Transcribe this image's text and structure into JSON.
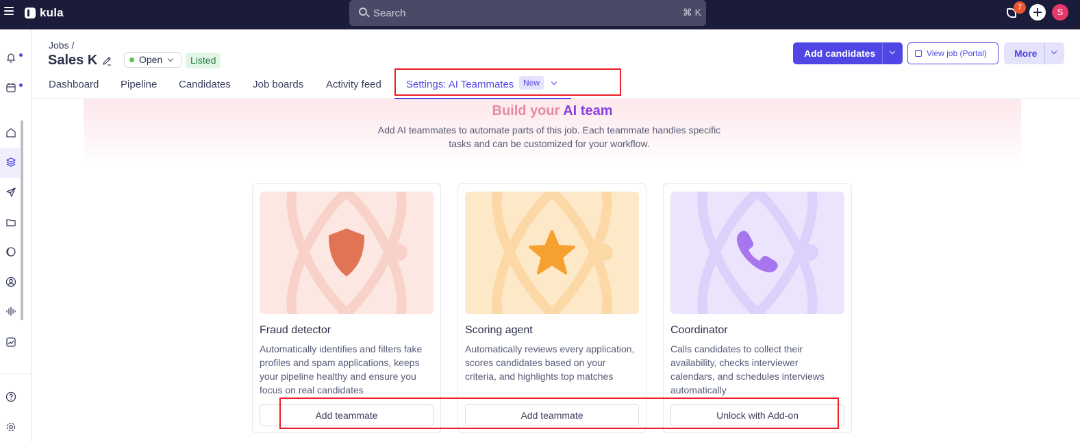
{
  "topbar": {
    "logo_text": "kula",
    "search_placeholder": "Search",
    "search_shortcut": "⌘ K",
    "notification_count": "7",
    "avatar_initial": "S"
  },
  "header": {
    "breadcrumb": "Jobs /",
    "job_title": "Sales K",
    "status": "Open",
    "listed_label": "Listed",
    "add_candidates_label": "Add candidates",
    "view_job_label": "View job (Portal)",
    "more_label": "More"
  },
  "tabs": [
    {
      "label": "Dashboard"
    },
    {
      "label": "Pipeline"
    },
    {
      "label": "Candidates"
    },
    {
      "label": "Job boards"
    },
    {
      "label": "Activity feed"
    },
    {
      "label": "Settings: AI Teammates",
      "badge": "New"
    }
  ],
  "banner": {
    "title_part1": "Build your",
    "title_part2": "AI team",
    "subtitle": "Add AI teammates to automate parts of this job. Each teammate handles specific tasks and can be customized for your workflow."
  },
  "cards": [
    {
      "title": "Fraud detector",
      "description": "Automatically identifies and filters fake profiles and spam applications, keeps your pipeline healthy and ensure you focus on real candidates",
      "button": "Add teammate",
      "icon": "shield-icon",
      "bg_color": "#fde7e2",
      "icon_color": "#e07454"
    },
    {
      "title": "Scoring agent",
      "description": "Automatically reviews every application, scores candidates based on your criteria, and highlights top matches",
      "button": "Add teammate",
      "icon": "star-icon",
      "bg_color": "#fde8c8",
      "icon_color": "#f6a02f"
    },
    {
      "title": "Coordinator",
      "description": "Calls candidates to collect their availability, checks interviewer calendars, and schedules interviews automatically",
      "button": "Unlock with Add-on",
      "icon": "phone-icon",
      "bg_color": "#ece4fc",
      "icon_color": "#a776ee"
    }
  ],
  "colors": {
    "accent": "#4f46e5",
    "topbar": "#1b1b3a",
    "highlight_box": "#ee1c24"
  }
}
